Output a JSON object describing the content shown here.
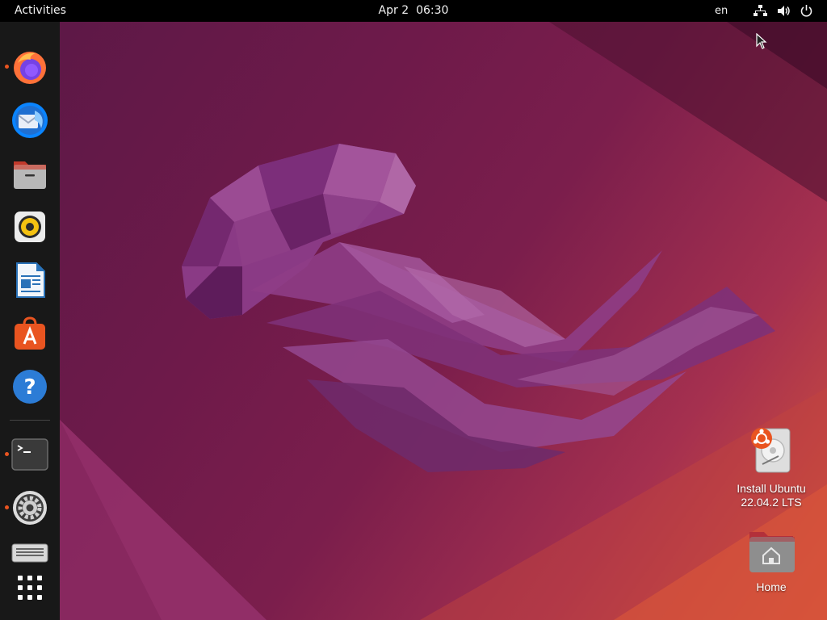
{
  "topbar": {
    "activities": "Activities",
    "date": "Apr 2",
    "time": "06:30",
    "language": "en",
    "tray_icons": [
      "network-icon",
      "volume-icon",
      "power-icon"
    ]
  },
  "dock": {
    "apps": [
      {
        "icon": "firefox-icon",
        "running": true
      },
      {
        "icon": "thunderbird-icon",
        "running": false
      },
      {
        "icon": "files-icon",
        "running": false
      },
      {
        "icon": "rhythmbox-icon",
        "running": false
      },
      {
        "icon": "libreoffice-writer-icon",
        "running": false
      },
      {
        "icon": "app-center-icon",
        "running": false
      },
      {
        "icon": "help-icon",
        "running": false
      },
      {
        "icon": "terminal-icon",
        "running": true
      },
      {
        "icon": "settings-icon",
        "running": true
      },
      {
        "icon": "disk-icon",
        "running": false
      },
      {
        "icon": "show-apps-icon",
        "running": false
      }
    ]
  },
  "desktop": {
    "install_ubuntu": {
      "line1": "Install Ubuntu",
      "line2": "22.04.2 LTS",
      "icon": "install-ubuntu-icon"
    },
    "home": {
      "label": "Home",
      "icon": "home-folder-icon"
    }
  },
  "colors": {
    "accent": "#e95420",
    "topbar_bg": "#000000",
    "dock_bg": "#181818"
  }
}
